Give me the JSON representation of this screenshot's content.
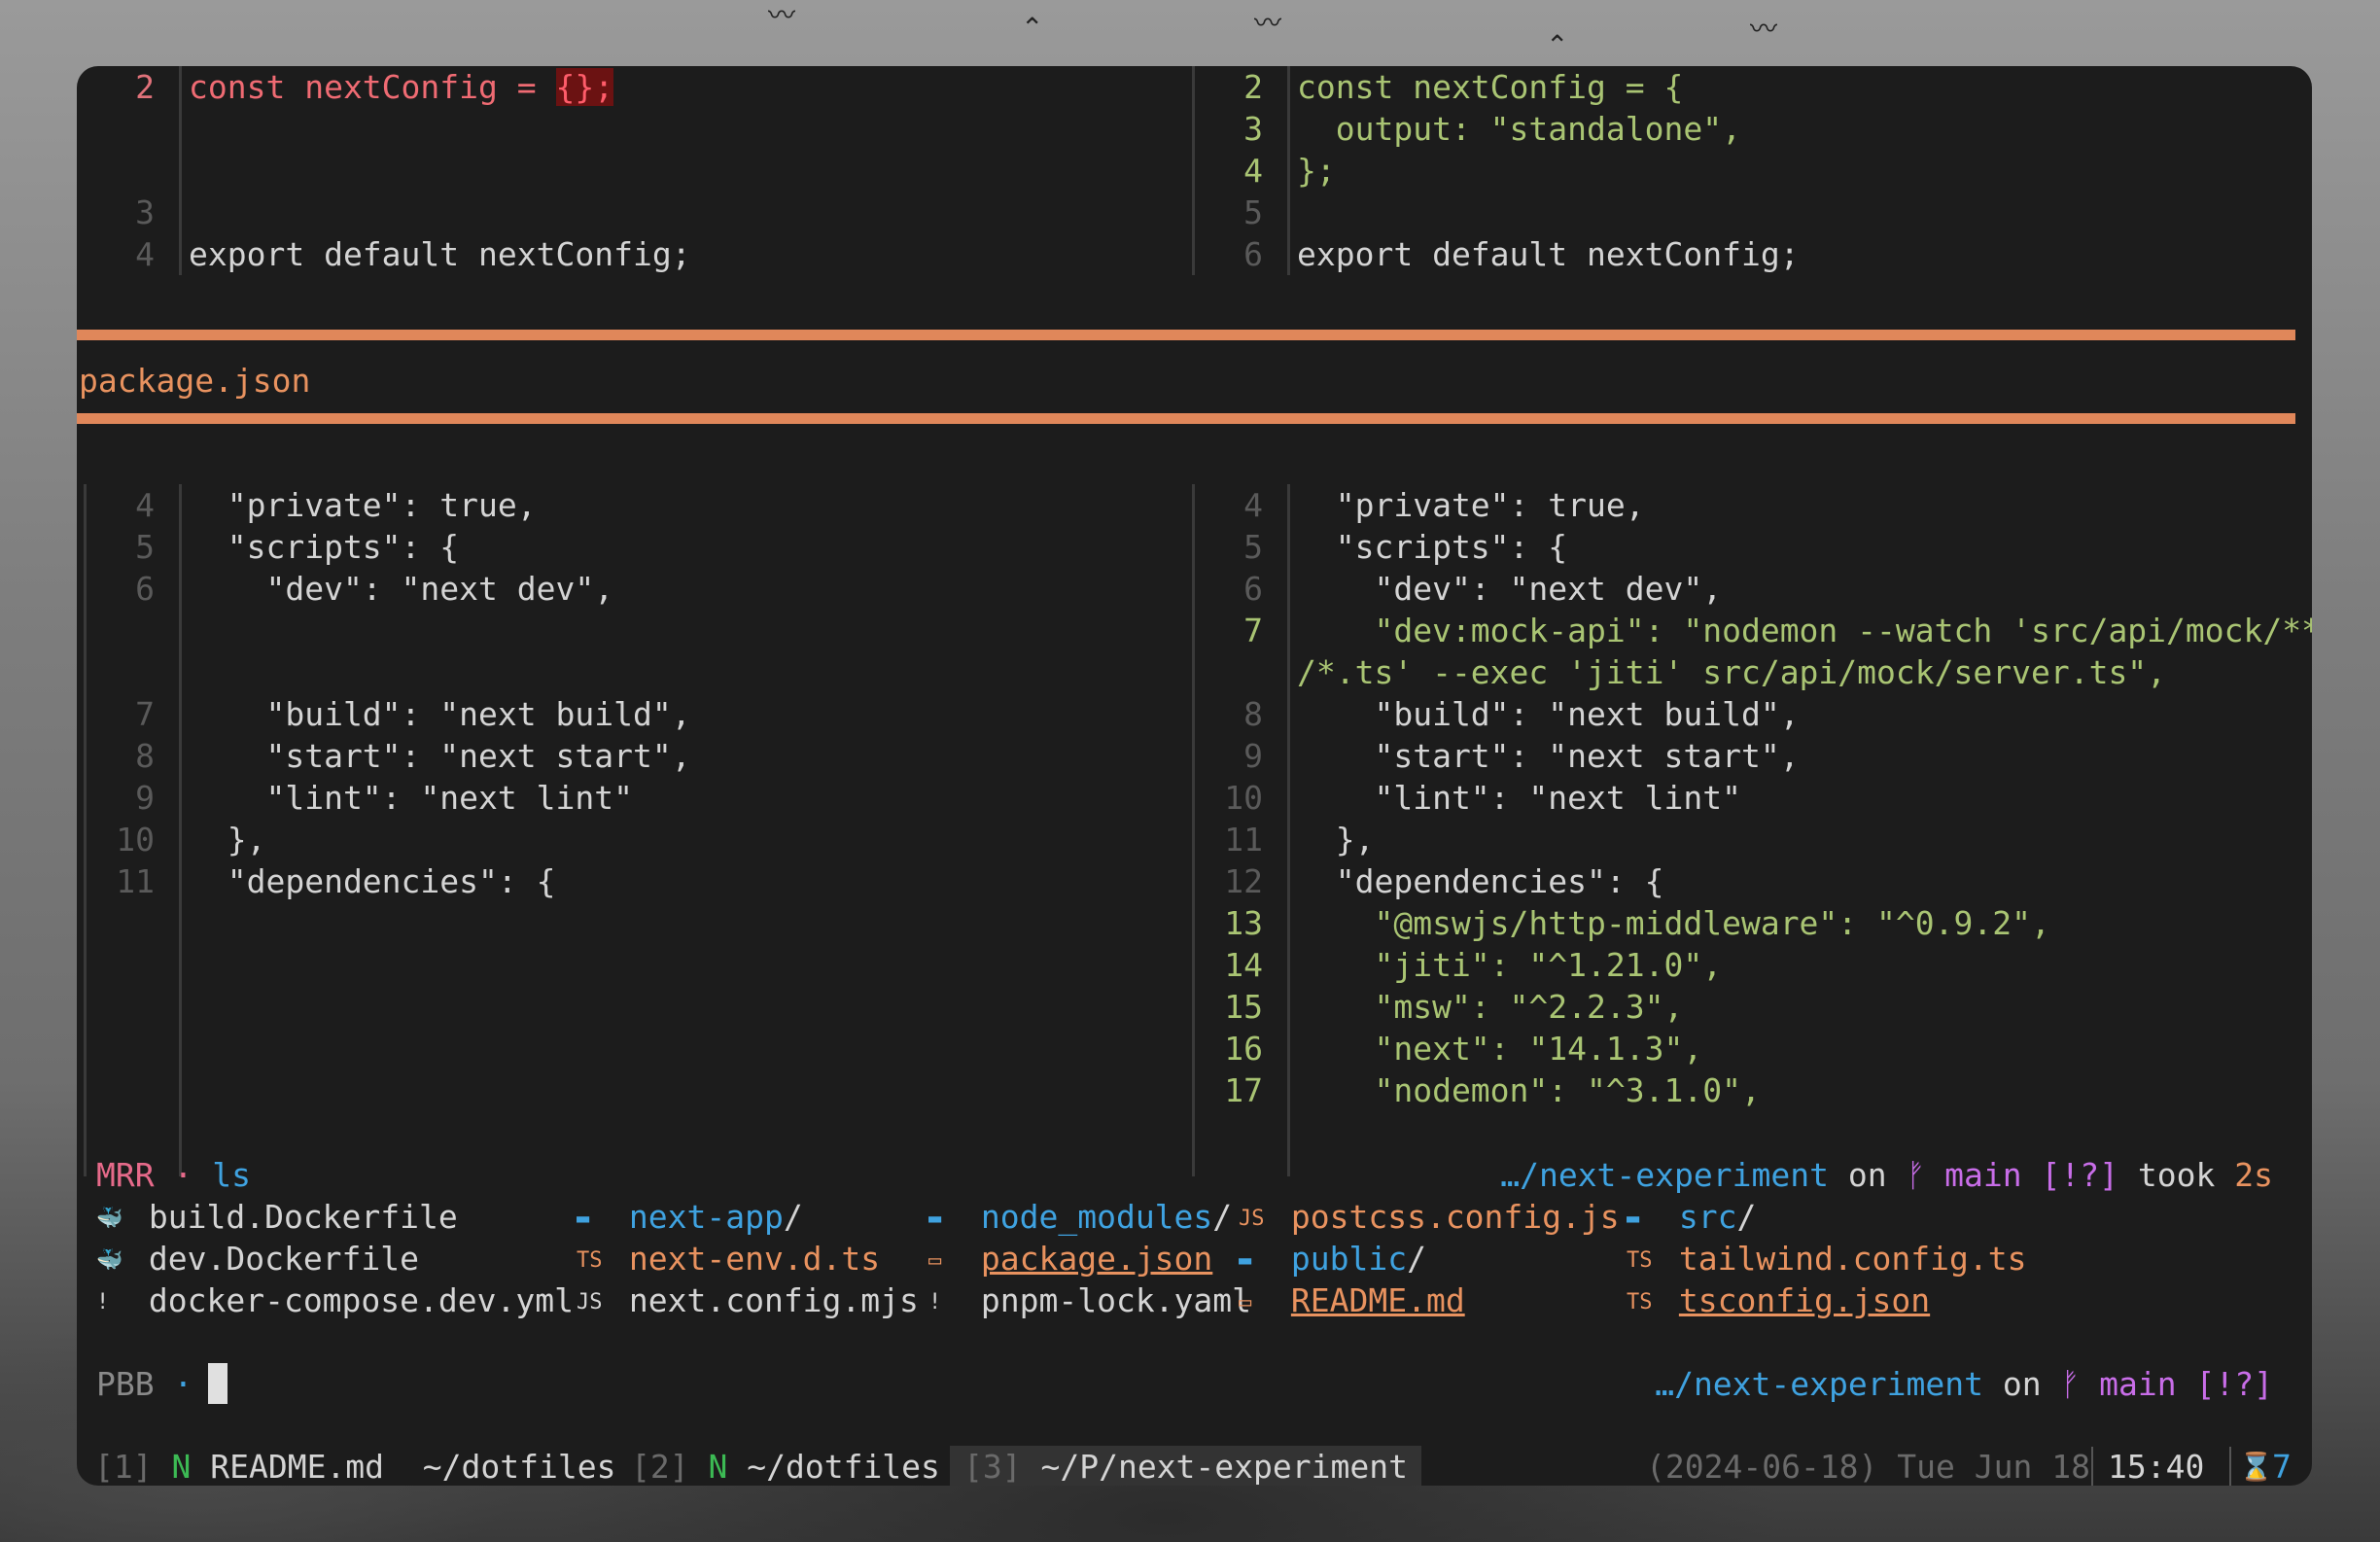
{
  "top_diff": {
    "left": [
      {
        "num": "2",
        "kind": "del",
        "pre": "const nextConfig = ",
        "hl": "{};",
        "post": ""
      },
      {
        "num": "3",
        "kind": "ctx",
        "text": ""
      },
      {
        "num": "4",
        "kind": "ctx",
        "text": "export default nextConfig;"
      }
    ],
    "right": [
      {
        "num": "2",
        "kind": "add",
        "text": "const nextConfig = {"
      },
      {
        "num": "3",
        "kind": "add",
        "text": "  output: \"standalone\","
      },
      {
        "num": "4",
        "kind": "add",
        "text": "};"
      },
      {
        "num": "5",
        "kind": "ctx",
        "text": ""
      },
      {
        "num": "6",
        "kind": "ctx",
        "text": "export default nextConfig;"
      }
    ]
  },
  "file_header": "package.json",
  "bottom_diff": {
    "left": [
      {
        "num": "4",
        "text": "  \"private\": true,"
      },
      {
        "num": "5",
        "text": "  \"scripts\": {"
      },
      {
        "num": "6",
        "text": "    \"dev\": \"next dev\","
      },
      {
        "num": "7",
        "text": "    \"build\": \"next build\","
      },
      {
        "num": "8",
        "text": "    \"start\": \"next start\","
      },
      {
        "num": "9",
        "text": "    \"lint\": \"next lint\""
      },
      {
        "num": "10",
        "text": "  },"
      },
      {
        "num": "11",
        "text": "  \"dependencies\": {"
      }
    ],
    "right": [
      {
        "num": "4",
        "text": "  \"private\": true,"
      },
      {
        "num": "5",
        "text": "  \"scripts\": {"
      },
      {
        "num": "6",
        "text": "    \"dev\": \"next dev\","
      },
      {
        "num": "7",
        "text": "    \"dev:mock-api\": \"nodemon --watch 'src/api/mock/**↵"
      },
      {
        "num": "",
        "text": "/*.ts' --exec 'jiti' src/api/mock/server.ts\","
      },
      {
        "num": "8",
        "text": "    \"build\": \"next build\","
      },
      {
        "num": "9",
        "text": "    \"start\": \"next start\","
      },
      {
        "num": "10",
        "text": "    \"lint\": \"next lint\""
      },
      {
        "num": "11",
        "text": "  },"
      },
      {
        "num": "12",
        "text": "  \"dependencies\": {"
      },
      {
        "num": "13",
        "text": "    \"@mswjs/http-middleware\": \"^0.9.2\","
      },
      {
        "num": "14",
        "text": "    \"jiti\": \"^1.21.0\","
      },
      {
        "num": "15",
        "text": "    \"msw\": \"^2.2.3\","
      },
      {
        "num": "16",
        "text": "    \"next\": \"14.1.3\","
      },
      {
        "num": "17",
        "text": "    \"nodemon\": \"^3.1.0\","
      }
    ]
  },
  "shell": {
    "prompt1_sym": "MRR",
    "dot": "·",
    "command": "ls",
    "path": "…/next-experiment",
    "on": "on",
    "branch_icon": "ᚠ",
    "branch": "main",
    "status": "[!?]",
    "took": "took",
    "duration": "2s",
    "prompt2_sym": "PBB",
    "ls": [
      {
        "icon": "docker-icon",
        "glyph": "🐳",
        "name": "build.Dockerfile",
        "color": "plain"
      },
      {
        "icon": "docker-icon",
        "glyph": "🐳",
        "name": "dev.Dockerfile",
        "color": "plain"
      },
      {
        "icon": "yaml-icon",
        "glyph": "!",
        "name": "docker-compose.dev.yml",
        "color": "plain"
      },
      {
        "icon": "folder-icon",
        "glyph": "▬",
        "name": "next-app",
        "suffix": "/",
        "color": "dir"
      },
      {
        "icon": "ts-icon",
        "glyph": "TS",
        "name": "next-env.d.ts",
        "color": "ts"
      },
      {
        "icon": "js-icon",
        "glyph": "JS",
        "name": "next.config.mjs",
        "color": "plain"
      },
      {
        "icon": "npm-folder-icon",
        "glyph": "▬",
        "name": "node_modules",
        "suffix": "/",
        "color": "dir"
      },
      {
        "icon": "npm-icon",
        "glyph": "▭",
        "name": "package.json",
        "color": "tsu"
      },
      {
        "icon": "yaml-icon",
        "glyph": "!",
        "name": "pnpm-lock.yaml",
        "color": "plain"
      },
      {
        "icon": "js-icon",
        "glyph": "JS",
        "name": "postcss.config.js",
        "color": "ts"
      },
      {
        "icon": "folder-icon",
        "glyph": "▬",
        "name": "public",
        "suffix": "/",
        "color": "dir"
      },
      {
        "icon": "markdown-icon",
        "glyph": "▭",
        "name": "README.md",
        "color": "tsu"
      },
      {
        "icon": "folder-icon",
        "glyph": "▬",
        "name": "src",
        "suffix": "/",
        "color": "dir"
      },
      {
        "icon": "ts-icon",
        "glyph": "TS",
        "name": "tailwind.config.ts",
        "color": "ts"
      },
      {
        "icon": "ts-icon",
        "glyph": "TS",
        "name": "tsconfig.json",
        "color": "tsu"
      }
    ]
  },
  "statusbar": {
    "tabs": [
      {
        "num": "[1]",
        "icon": "N",
        "label": "README.md  ~/dotfiles"
      },
      {
        "num": "[2]",
        "icon": "N",
        "label": "~/dotfiles"
      },
      {
        "num": "[3]",
        "icon": "",
        "label": "~/P/next-experiment"
      }
    ],
    "date": "(2024-06-18) Tue Jun 18",
    "time": "15:40",
    "hourglass": "⌛",
    "count": "7"
  },
  "colors": {
    "accent_orange": "#e0875a",
    "added_green": "#a9c473",
    "removed_red": "#ef6b73",
    "dir_blue": "#3fa2e0",
    "branch_purple": "#c86de8"
  }
}
